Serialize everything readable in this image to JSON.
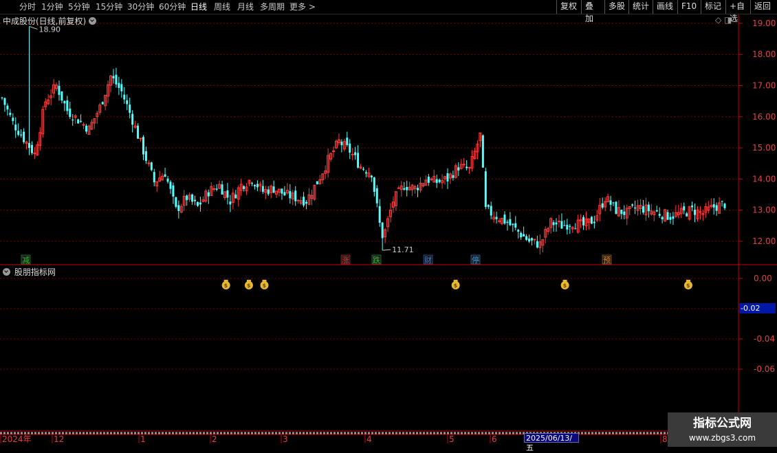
{
  "toolbar": {
    "periods": [
      "分时",
      "1分钟",
      "5分钟",
      "15分钟",
      "30分钟",
      "60分钟",
      "日线",
      "周线",
      "月线",
      "多周期",
      "更多 >"
    ],
    "active_period": "日线",
    "right_buttons": [
      "复权",
      "叠加",
      "多股",
      "统计",
      "画线",
      "F10",
      "标记",
      "+自选",
      "返回"
    ]
  },
  "main_panel": {
    "title": "中成股份(日线,前复权)",
    "high_label": "18.90",
    "low_label": "11.71"
  },
  "indicator_panel": {
    "title": "股朋指标网",
    "current_value": "-0.02"
  },
  "event_markers": [
    {
      "text": "减",
      "color": "#28c828"
    },
    {
      "text": "涨",
      "color": "#e83030"
    },
    {
      "text": "跌",
      "color": "#28c828"
    },
    {
      "text": "财",
      "color": "#3a7ae0"
    },
    {
      "text": "停",
      "color": "#3a9ae0"
    },
    {
      "text": "预",
      "color": "#e08a20"
    }
  ],
  "time_axis": {
    "labels": [
      "2024年",
      "12",
      "1",
      "2",
      "3",
      "4",
      "5",
      "6",
      "8"
    ],
    "selected_date": "2025/06/13/五"
  },
  "watermark": {
    "line1": "指标公式网",
    "line2": "www.zbgs3.com"
  },
  "colors": {
    "up": "#ff3c3c",
    "down": "#54ffff",
    "grid": "#7a0000",
    "axis": "#c8000a",
    "money_bag": "#e8b830"
  },
  "chart_data": [
    {
      "type": "candlestick",
      "title": "中成股份(日线,前复权)",
      "ylim": [
        11.71,
        18.9
      ],
      "y_ticks": [
        "19.00",
        "18.00",
        "17.00",
        "16.00",
        "15.00",
        "14.00",
        "13.00",
        "12.00"
      ],
      "y_tick_values": [
        19,
        18,
        17,
        16,
        15,
        14,
        13,
        12
      ],
      "x_tick_labels": [
        "2024年",
        "12",
        "1",
        "2",
        "3",
        "4",
        "5",
        "6",
        "8"
      ],
      "high": 18.9,
      "low": 11.71,
      "keypoints_close": [
        [
          0,
          16.6
        ],
        [
          4,
          15.8
        ],
        [
          8,
          15.3
        ],
        [
          12,
          14.8
        ],
        [
          16,
          16.5
        ],
        [
          20,
          17.0
        ],
        [
          24,
          16.2
        ],
        [
          28,
          15.9
        ],
        [
          32,
          15.6
        ],
        [
          36,
          16.3
        ],
        [
          40,
          17.3
        ],
        [
          44,
          16.8
        ],
        [
          48,
          15.9
        ],
        [
          52,
          14.9
        ],
        [
          56,
          13.9
        ],
        [
          60,
          14.2
        ],
        [
          64,
          13.0
        ],
        [
          68,
          13.4
        ],
        [
          72,
          13.1
        ],
        [
          76,
          13.6
        ],
        [
          80,
          13.8
        ],
        [
          84,
          13.3
        ],
        [
          88,
          13.8
        ],
        [
          92,
          14.0
        ],
        [
          96,
          13.6
        ],
        [
          100,
          13.7
        ],
        [
          104,
          13.5
        ],
        [
          108,
          13.4
        ],
        [
          112,
          13.3
        ],
        [
          116,
          13.9
        ],
        [
          120,
          14.6
        ],
        [
          124,
          15.2
        ],
        [
          128,
          14.9
        ],
        [
          132,
          14.4
        ],
        [
          136,
          14.2
        ],
        [
          140,
          12.0
        ],
        [
          144,
          13.3
        ],
        [
          148,
          13.8
        ],
        [
          152,
          13.7
        ],
        [
          156,
          14.0
        ],
        [
          160,
          13.9
        ],
        [
          164,
          14.0
        ],
        [
          168,
          14.4
        ],
        [
          172,
          14.3
        ],
        [
          176,
          15.4
        ],
        [
          178,
          13.0
        ],
        [
          182,
          12.8
        ],
        [
          186,
          12.6
        ],
        [
          190,
          12.3
        ],
        [
          194,
          12.0
        ],
        [
          198,
          11.9
        ],
        [
          202,
          12.6
        ],
        [
          206,
          12.5
        ],
        [
          210,
          12.6
        ],
        [
          214,
          12.5
        ],
        [
          218,
          12.7
        ],
        [
          222,
          13.4
        ],
        [
          226,
          13.0
        ],
        [
          230,
          12.9
        ],
        [
          234,
          13.1
        ],
        [
          238,
          13.0
        ],
        [
          242,
          12.9
        ],
        [
          246,
          12.8
        ],
        [
          250,
          12.9
        ],
        [
          254,
          13.0
        ],
        [
          258,
          12.9
        ],
        [
          262,
          13.1
        ],
        [
          266,
          13.2
        ]
      ]
    },
    {
      "type": "indicator",
      "title": "股朋指标网",
      "y_ticks": [
        "0.00",
        "-0.02",
        "-0.04",
        "-0.06"
      ],
      "y_tick_values": [
        0.0,
        -0.02,
        -0.04,
        -0.06
      ],
      "current_value": -0.02,
      "signal_icons": "money-bag",
      "signal_x_fraction": [
        0.306,
        0.337,
        0.358,
        0.617,
        0.765,
        0.932
      ]
    }
  ]
}
